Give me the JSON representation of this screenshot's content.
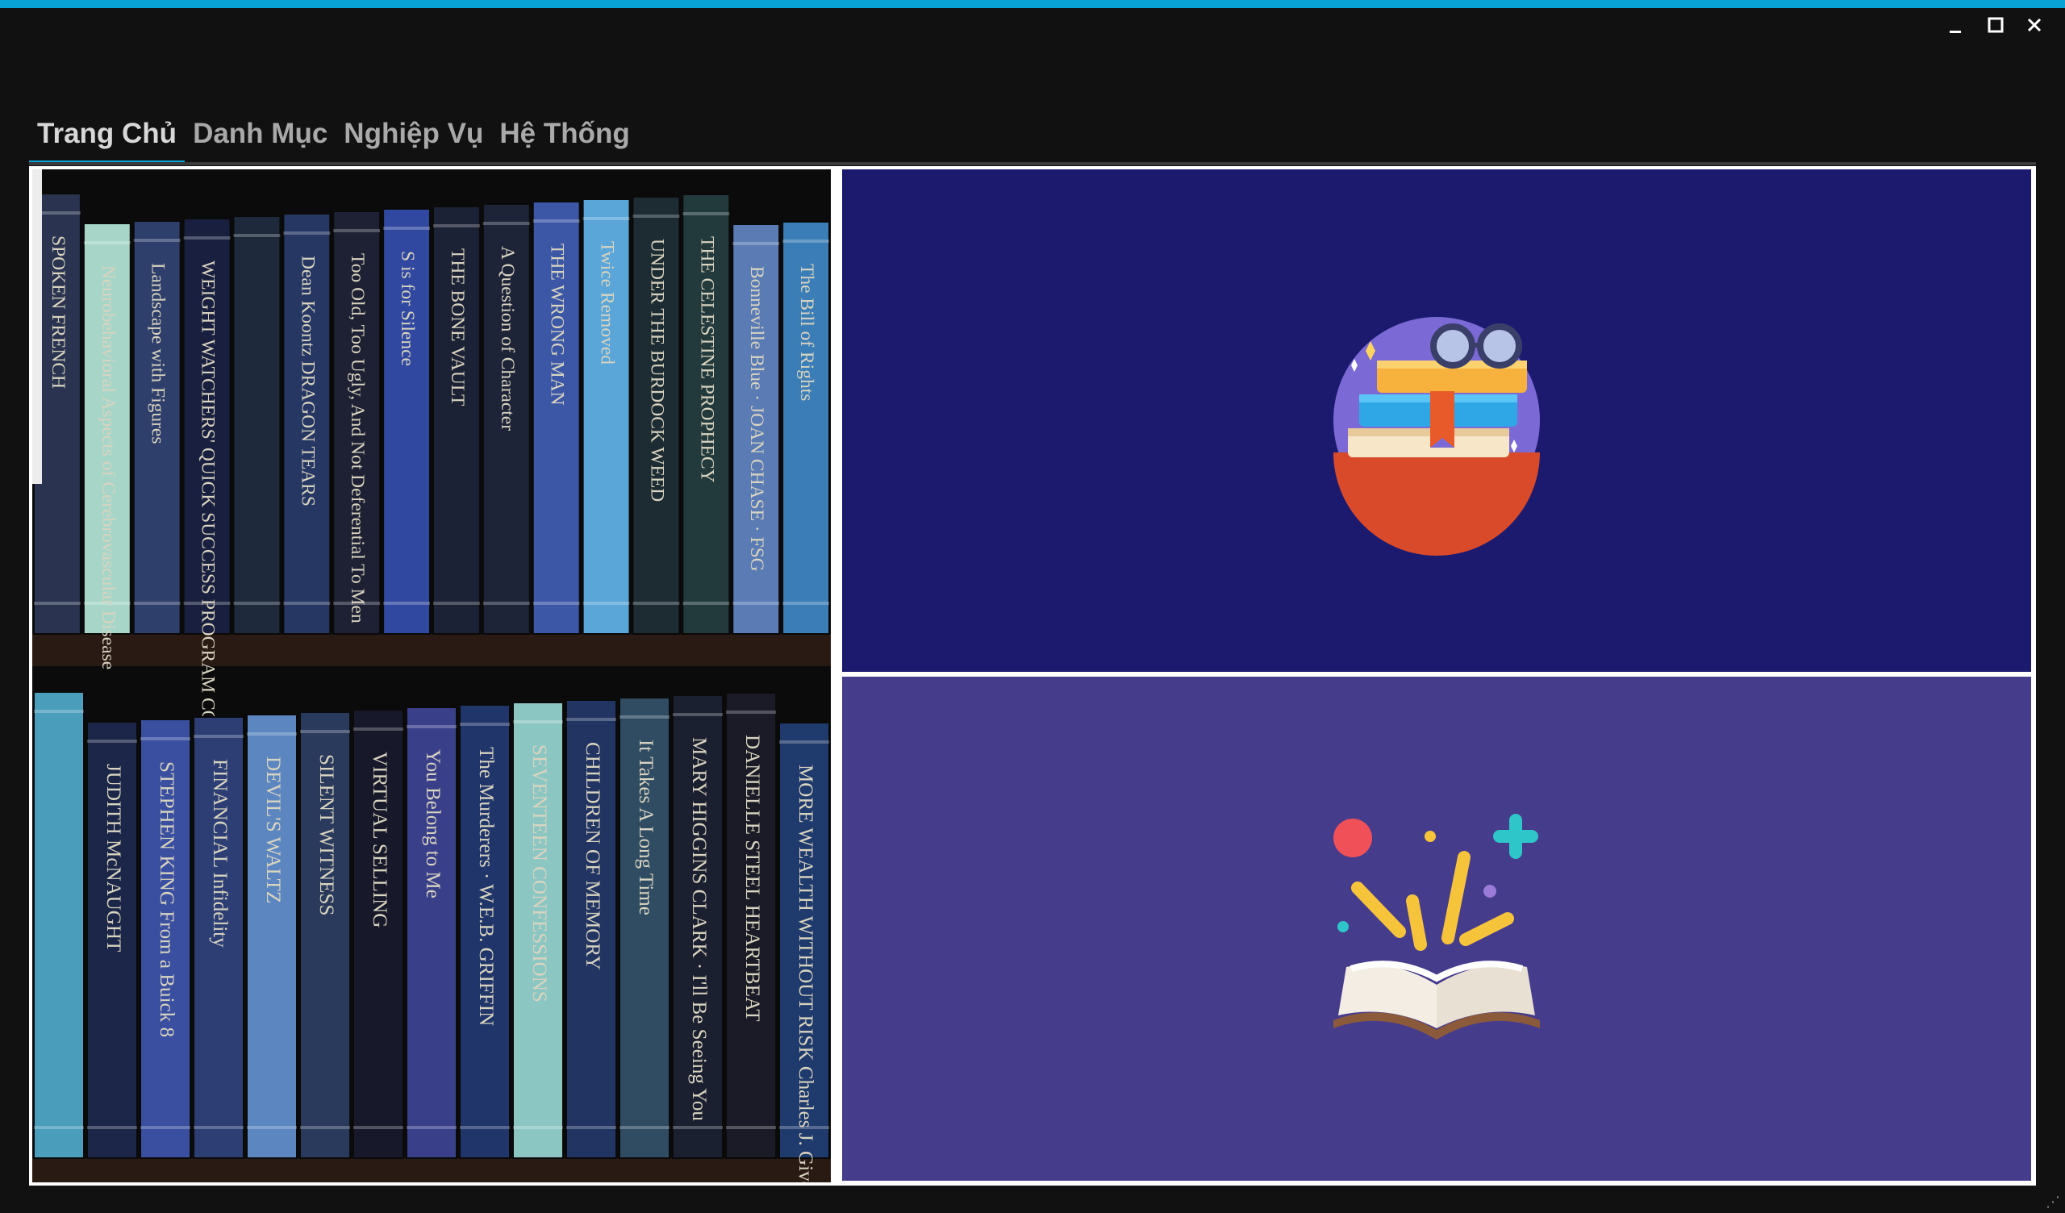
{
  "window": {
    "minimize_icon": "minimize-icon",
    "maximize_icon": "maximize-icon",
    "close_icon": "close-icon",
    "minimize_label": "‗",
    "maximize_label": "◻",
    "close_label": "✕"
  },
  "menu": {
    "items": [
      {
        "label": "Trang Chủ",
        "active": true
      },
      {
        "label": "Danh Mục",
        "active": false
      },
      {
        "label": "Nghiệp Vụ",
        "active": false
      },
      {
        "label": "Hệ Thống",
        "active": false
      }
    ]
  },
  "books_top": [
    {
      "title": "SPOKEN FRENCH",
      "color": "#2a3450"
    },
    {
      "title": "Neurobehavioral Aspects of Cerebrovascular Disease",
      "color": "#a7d6c9"
    },
    {
      "title": "Landscape with Figures",
      "color": "#2f3f6b"
    },
    {
      "title": "WEIGHT WATCHERS' QUICK SUCCESS PROGRAM COOKBOOK",
      "color": "#19203f"
    },
    {
      "title": "",
      "color": "#1e2a3c"
    },
    {
      "title": "Dean Koontz DRAGON TEARS",
      "color": "#263764"
    },
    {
      "title": "Too Old, Too Ugly, And Not Deferential To Men",
      "color": "#1d2133"
    },
    {
      "title": "S is for Silence",
      "color": "#3048a0"
    },
    {
      "title": "THE BONE VAULT",
      "color": "#1c2235"
    },
    {
      "title": "A Question of Character",
      "color": "#1d2438"
    },
    {
      "title": "THE WRONG MAN",
      "color": "#3b57a6"
    },
    {
      "title": "Twice Removed",
      "color": "#5aa6d8"
    },
    {
      "title": "UNDER THE BURDOCK WEED",
      "color": "#1d2c33"
    },
    {
      "title": "THE CELESTINE PROPHECY",
      "color": "#233a3d"
    },
    {
      "title": "Bonneville Blue · JOAN CHASE · FSG",
      "color": "#5a7bb4"
    },
    {
      "title": "The Bill of Rights",
      "color": "#3b7db6"
    }
  ],
  "books_bottom": [
    {
      "title": "",
      "color": "#4a9dbb"
    },
    {
      "title": "JUDITH McNAUGHT",
      "color": "#1b2648"
    },
    {
      "title": "STEPHEN KING From a Buick 8",
      "color": "#3a4fa0"
    },
    {
      "title": "FINANCIAL Infidelity",
      "color": "#2c3e74"
    },
    {
      "title": "DEVIL'S WALTZ",
      "color": "#5b86c0"
    },
    {
      "title": "SILENT WITNESS",
      "color": "#2a3a5c"
    },
    {
      "title": "VIRTUAL SELLING",
      "color": "#17182a"
    },
    {
      "title": "You Belong to Me",
      "color": "#3a3f8a"
    },
    {
      "title": "The Murderers · W.E.B. GRIFFIN",
      "color": "#20356a"
    },
    {
      "title": "SEVENTEEN CONFESSIONS",
      "color": "#8cc6c2"
    },
    {
      "title": "CHILDREN OF MEMORY",
      "color": "#213462"
    },
    {
      "title": "It Takes A Long Time",
      "color": "#2f4c63"
    },
    {
      "title": "MARY HIGGINS CLARK · I'll Be Seeing You",
      "color": "#1b2030"
    },
    {
      "title": "DANIELLE STEEL HEARTBEAT",
      "color": "#1a1b26"
    },
    {
      "title": "MORE WEALTH WITHOUT RISK Charles J. Givens",
      "color": "#1f3a6c"
    }
  ],
  "icons": {
    "top": "books-with-glasses-icon",
    "bottom": "open-book-icon"
  }
}
